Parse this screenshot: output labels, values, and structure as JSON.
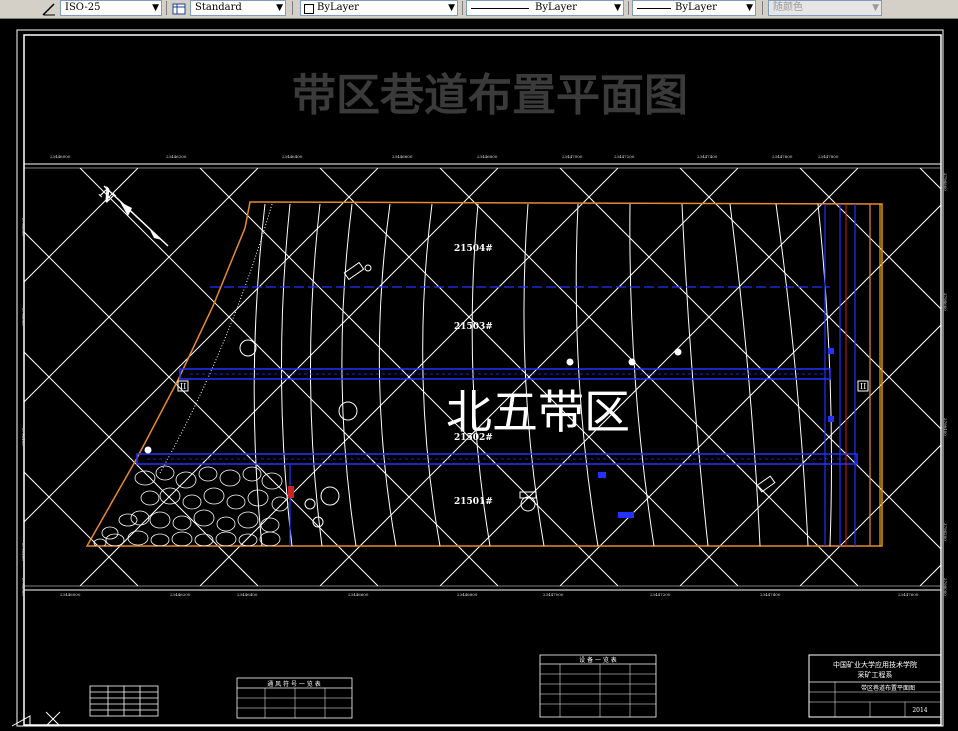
{
  "toolbar": {
    "dimstyle": "ISO-25",
    "tablestyle": "Standard",
    "layer": "ByLayer",
    "linetype": "ByLayer",
    "lineweight": "ByLayer",
    "plotstyle": "随颜色"
  },
  "drawing": {
    "title": "带区巷道布置平面图",
    "district_label": "北五带区",
    "north_label": "N",
    "panels": [
      "21504#",
      "21503#",
      "21502#",
      "21501#"
    ],
    "markers": [
      "II",
      "II"
    ],
    "titleblock": {
      "school": "中国矿业大学应用技术学院",
      "dept": "采矿工程系",
      "drawing_name": "带区巷道布置平面图",
      "year": "2014"
    },
    "legend_mid": "通 风 符 号 一 览 表",
    "legend_right": "设 备 一 览 表"
  },
  "coords": {
    "top": [
      "23446000",
      "23446200",
      "23446400",
      "23446600",
      "23446800",
      "23447000",
      "23447200",
      "23447400",
      "23447600",
      "23447800"
    ],
    "bottom": [
      "23446000",
      "23446200",
      "23446400",
      "23446600",
      "23446800",
      "23447000",
      "23447200",
      "23447400",
      "23447600"
    ],
    "left": [
      "3798800",
      "3798600",
      "3798400",
      "3798200",
      "3798000"
    ],
    "right": [
      "3798800",
      "3798600",
      "3798400",
      "3798200",
      "3798000"
    ]
  }
}
